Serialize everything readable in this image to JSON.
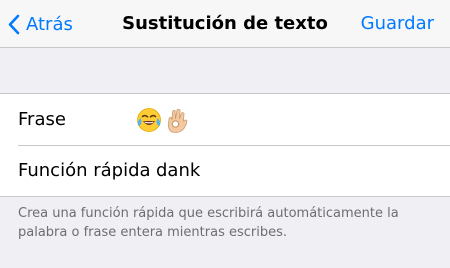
{
  "nav": {
    "back_label": "Atrás",
    "title": "Sustitución de texto",
    "save_label": "Guardar"
  },
  "form": {
    "phrase_label": "Frase",
    "phrase_value_icons": [
      "face-with-tears-of-joy-emoji",
      "ok-hand-emoji"
    ],
    "shortcut_label": "Función rápida",
    "shortcut_value": "dank"
  },
  "footer": {
    "note": "Crea una función rápida que escribirá automáticamente la palabra o frase entera mientras escribes."
  },
  "colors": {
    "accent": "#007aff",
    "background": "#efeff4",
    "separator": "#c8c7cc",
    "footer_text": "#6d6d72"
  }
}
